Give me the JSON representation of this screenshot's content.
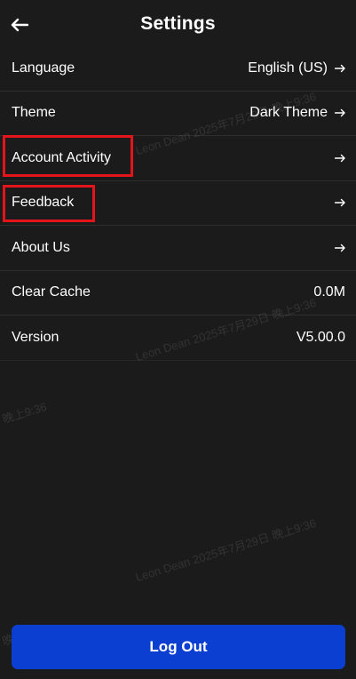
{
  "header": {
    "title": "Settings",
    "back_icon": "arrow-left-icon"
  },
  "settings": [
    {
      "label": "Language",
      "value": "English (US)",
      "icon": "arrow-right-icon"
    },
    {
      "label": "Theme",
      "value": "Dark Theme",
      "icon": "arrow-right-icon"
    },
    {
      "label": "Account Activity",
      "value": "",
      "icon": "arrow-right-icon"
    },
    {
      "label": "Feedback",
      "value": "",
      "icon": "arrow-right-icon"
    },
    {
      "label": "About Us",
      "value": "",
      "icon": "arrow-right-icon"
    },
    {
      "label": "Clear Cache",
      "value": "0.0M"
    },
    {
      "label": "Version",
      "value": "V5.00.0"
    }
  ],
  "watermark": {
    "full": "Leon Dean 2025年7月29日 晚上9:36",
    "short": "晚上9:36"
  },
  "footer": {
    "logout_label": "Log Out"
  },
  "colors": {
    "background": "#1b1b1b",
    "accent_button": "#0b3fd1",
    "highlight_box": "#e3151b"
  }
}
